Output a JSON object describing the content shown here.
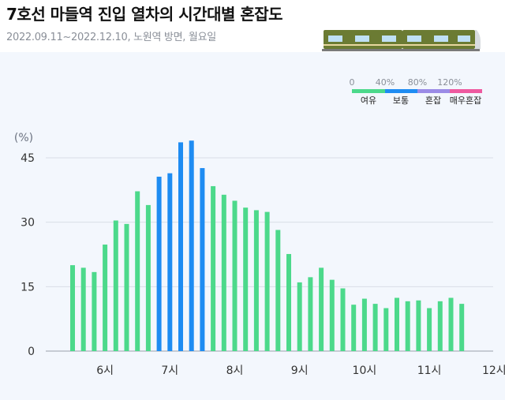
{
  "header": {
    "title": "7호선 마들역 진입 열차의 시간대별 혼잡도",
    "subtitle": "2022.09.11~2022.12.10, 노원역 방면, 월요일"
  },
  "colors": {
    "yeoyu": "#4cd98b",
    "botong": "#1e8cf2",
    "honjap": "#9b8be6",
    "maeu_honjap": "#ee5aa0",
    "grid": "#d9dee6",
    "panel": "#f3f7fd",
    "train_body": "#6b7b33",
    "train_window": "#bfe0f5"
  },
  "legend": {
    "ticks": [
      "0",
      "40%",
      "80%",
      "120%"
    ],
    "labels": [
      "여유",
      "보통",
      "혼잡",
      "매우혼잡"
    ]
  },
  "chart_data": {
    "type": "bar",
    "unit_label": "(%)",
    "ylim": [
      0,
      50
    ],
    "yticks": [
      0,
      15,
      30,
      45
    ],
    "xtick_labels": [
      "6시",
      "7시",
      "8시",
      "9시",
      "10시",
      "11시",
      "12시"
    ],
    "x_time_start": "05:30",
    "x_interval_minutes": 10,
    "values": [
      20.0,
      19.4,
      18.4,
      24.8,
      30.4,
      29.6,
      37.2,
      34.0,
      40.6,
      41.4,
      48.6,
      49.0,
      42.6,
      38.4,
      36.4,
      35.0,
      33.4,
      32.8,
      32.4,
      28.2,
      22.6,
      16.0,
      17.2,
      19.4,
      16.6,
      14.6,
      10.8,
      12.2,
      11.0,
      10.0,
      12.4,
      11.6,
      11.8,
      10.0,
      11.6,
      12.4,
      11.0
    ],
    "categories": [
      "여유",
      "여유",
      "여유",
      "여유",
      "여유",
      "여유",
      "여유",
      "여유",
      "보통",
      "보통",
      "보통",
      "보통",
      "보통",
      "여유",
      "여유",
      "여유",
      "여유",
      "여유",
      "여유",
      "여유",
      "여유",
      "여유",
      "여유",
      "여유",
      "여유",
      "여유",
      "여유",
      "여유",
      "여유",
      "여유",
      "여유",
      "여유",
      "여유",
      "여유",
      "여유",
      "여유",
      "여유"
    ],
    "grid": true
  }
}
